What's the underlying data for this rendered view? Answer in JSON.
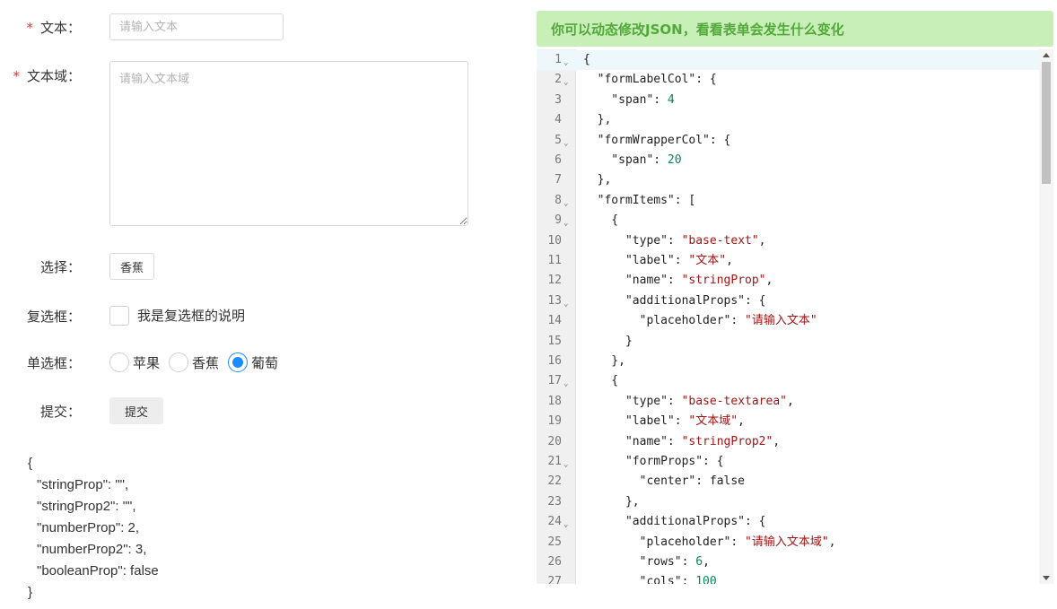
{
  "form": {
    "text_label": "文本：",
    "text_placeholder": "请输入文本",
    "textarea_label": "文本域：",
    "textarea_placeholder": "请输入文本域",
    "select_label": "选择：",
    "select_value": "香蕉",
    "checkbox_label": "复选框：",
    "checkbox_desc": "我是复选框的说明",
    "checkbox_checked": false,
    "radio_label": "单选框：",
    "radio_options": [
      {
        "label": "苹果",
        "checked": false
      },
      {
        "label": "香蕉",
        "checked": false
      },
      {
        "label": "葡萄",
        "checked": true
      }
    ],
    "submit_label": "提交：",
    "submit_button": "提交",
    "required_mark": "*"
  },
  "output": {
    "open": "{",
    "lines": [
      "\"stringProp\": \"\",",
      "\"stringProp2\": \"\",",
      "\"numberProp\": 2,",
      "\"numberProp2\": 3,",
      "\"booleanProp\": false"
    ],
    "close": "}"
  },
  "banner": "你可以动态修改JSON，看看表单会发生什么变化",
  "editor": {
    "lines": [
      {
        "n": "1",
        "fold": true,
        "code": "{"
      },
      {
        "n": "2",
        "fold": true,
        "code": "  \"formLabelCol\": {"
      },
      {
        "n": "3",
        "fold": false,
        "code": "    \"span\": 4"
      },
      {
        "n": "4",
        "fold": false,
        "code": "  },"
      },
      {
        "n": "5",
        "fold": true,
        "code": "  \"formWrapperCol\": {"
      },
      {
        "n": "6",
        "fold": false,
        "code": "    \"span\": 20"
      },
      {
        "n": "7",
        "fold": false,
        "code": "  },"
      },
      {
        "n": "8",
        "fold": true,
        "code": "  \"formItems\": ["
      },
      {
        "n": "9",
        "fold": true,
        "code": "    {"
      },
      {
        "n": "10",
        "fold": false,
        "code": "      \"type\": \"base-text\","
      },
      {
        "n": "11",
        "fold": false,
        "code": "      \"label\": \"文本\","
      },
      {
        "n": "12",
        "fold": false,
        "code": "      \"name\": \"stringProp\","
      },
      {
        "n": "13",
        "fold": true,
        "code": "      \"additionalProps\": {"
      },
      {
        "n": "14",
        "fold": false,
        "code": "        \"placeholder\": \"请输入文本\""
      },
      {
        "n": "15",
        "fold": false,
        "code": "      }"
      },
      {
        "n": "16",
        "fold": false,
        "code": "    },"
      },
      {
        "n": "17",
        "fold": true,
        "code": "    {"
      },
      {
        "n": "18",
        "fold": false,
        "code": "      \"type\": \"base-textarea\","
      },
      {
        "n": "19",
        "fold": false,
        "code": "      \"label\": \"文本域\","
      },
      {
        "n": "20",
        "fold": false,
        "code": "      \"name\": \"stringProp2\","
      },
      {
        "n": "21",
        "fold": true,
        "code": "      \"formProps\": {"
      },
      {
        "n": "22",
        "fold": false,
        "code": "        \"center\": false"
      },
      {
        "n": "23",
        "fold": false,
        "code": "      },"
      },
      {
        "n": "24",
        "fold": true,
        "code": "      \"additionalProps\": {"
      },
      {
        "n": "25",
        "fold": false,
        "code": "        \"placeholder\": \"请输入文本域\","
      },
      {
        "n": "26",
        "fold": false,
        "code": "        \"rows\": 6,"
      },
      {
        "n": "27",
        "fold": false,
        "code": "        \"cols\": 100"
      }
    ]
  },
  "colors": {
    "banner_bg": "#c8efb8",
    "banner_text": "#52a83a",
    "radio_checked": "#1a8cff",
    "required": "#e4393c",
    "string": "#a31515",
    "number": "#098658"
  }
}
